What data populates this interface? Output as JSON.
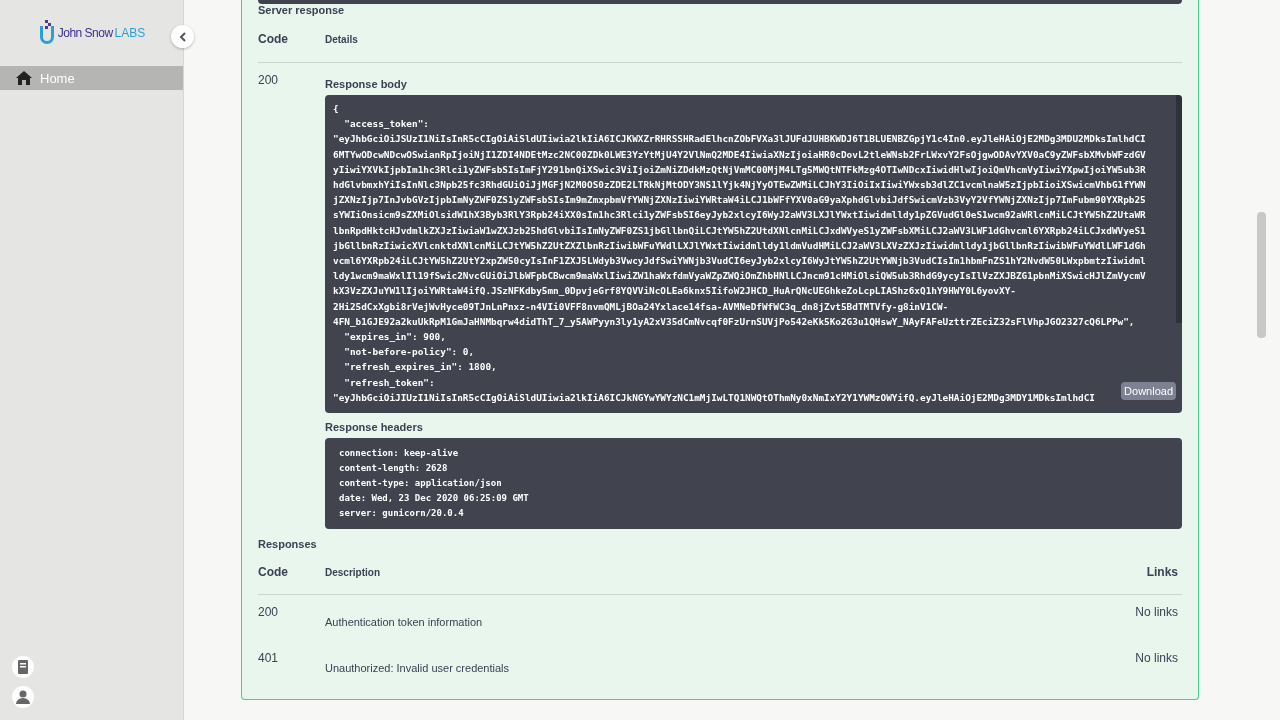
{
  "sidebar": {
    "logo": {
      "name": "John Snow",
      "suffix": "LABS"
    },
    "items": [
      {
        "label": "Home",
        "selected": true
      }
    ]
  },
  "server_response": {
    "title": "Server response",
    "columns": [
      "Code",
      "Details"
    ],
    "code": "200",
    "body_label": "Response body",
    "body_lines": [
      "{",
      "  \"access_token\":",
      "\"eyJhbGciOiJSUzI1NiIsInR5cCIgOiAiSldUIiwia2lkIiA6ICJKWXZrRHRSSHRadElhcnZObFVXa3lJUFdJUHBKWDJ6T1BLUENBZGpjY1c4In0.eyJleHAiOjE2MDg3MDU2MDksImlhdCI",
      "6MTYwODcwNDcwOSwianRpIjoiNjI1ZDI4NDEtMzc2NC00ZDk0LWE3YzYtMjU4Y2VlNmQ2MDE4IiwiaXNzIjoiaHR0cDovL2tleWNsb2FrLWxvY2FsOjgwODAvYXV0aC9yZWFsbXMvbWFzdGV",
      "yIiwiYXVkIjpbIm1hc3Rlci1yZWFsbSIsImFjY291bnQiXSwic3ViIjoiZmNiZDdkMzQtNjVmMC00MjM4LTg5MWQtNTFkMzg4OTIwNDcxIiwidHlwIjoiQmVhcmVyIiwiYXpwIjoiYW5ub3R",
      "hdGlvbmxhYiIsInNlc3Npb25fc3RhdGUiOiJjMGFjN2M0OS0zZDE2LTRkNjMtODY3NS1lYjk4NjYyOTEwZWMiLCJhY3IiOiIxIiwiYWxsb3dlZC1vcmlnaW5zIjpbIioiXSwicmVhbG1fYWN",
      "jZXNzIjp7InJvbGVzIjpbImNyZWF0ZS1yZWFsbSIsIm9mZmxpbmVfYWNjZXNzIiwiYWRtaW4iLCJ1bWFfYXV0aG9yaXphdGlvbiJdfSwicmVzb3VyY2VfYWNjZXNzIjp7ImFubm90YXRpb25",
      "sYWIiOnsicm9sZXMiOlsidW1hX3Byb3RlY3Rpb24iXX0sIm1hc3Rlci1yZWFsbSI6eyJyb2xlcyI6WyJ2aWV3LXJlYWxtIiwidmlldy1pZGVudGl0eS1wcm92aWRlcnMiLCJtYW5hZ2UtaWR",
      "lbnRpdHktcHJvdmlkZXJzIiwiaW1wZXJzb25hdGlvbiIsImNyZWF0ZS1jbGllbnQiLCJtYW5hZ2UtdXNlcnMiLCJxdWVyeS1yZWFsbXMiLCJ2aWV3LWF1dGhvcml6YXRpb24iLCJxdWVyeS1",
      "jbGllbnRzIiwicXVlcnktdXNlcnMiLCJtYW5hZ2UtZXZlbnRzIiwibWFuYWdlLXJlYWxtIiwidmlldy1ldmVudHMiLCJ2aWV3LXVzZXJzIiwidmlldy1jbGllbnRzIiwibWFuYWdlLWF1dGh",
      "vcml6YXRpb24iLCJtYW5hZ2UtY2xpZW50cyIsInF1ZXJ5LWdyb3VwcyJdfSwiYWNjb3VudCI6eyJyb2xlcyI6WyJtYW5hZ2UtYWNjb3VudCIsIm1hbmFnZS1hY2NvdW50LWxpbmtzIiwidml",
      "ldy1wcm9maWxlIl19fSwic2NvcGUiOiJlbWFpbCBwcm9maWxlIiwiZW1haWxfdmVyaWZpZWQiOmZhbHNlLCJncm91cHMiOlsiQW5ub3RhdG9ycyIsIlVzZXJBZG1pbnMiXSwicHJlZmVycmV",
      "kX3VzZXJuYW1lIjoiYWRtaW4ifQ.JSzNFKdby5mn_0DpvjeGrf8YQVViNcOLEa6knx5IifoW2JHCD_HuArQNcUEGhkeZoLcpLIAShz6xQ1hY9HWY0L6yovXY-",
      "2Hi25dCxXgbi8rVejWvHyce09TJnLnPnxz-n4VIi0VFF8nvmQMLjBOa24Yxlace14fsa-AVMNeDfWfWC3q_dn8jZvt5BdTMTVfy-g8inV1CW-",
      "4FN_b1GJE92a2kuUkRpM1GmJaHNMbqrw4didThT_7_y5AWPyyn3ly1yA2xV35dCmNvcqf0FzUrnSUVjPo542eKk5Ko2G3u1QHswY_NAyFAFeUzttrZEciZ32sFlVhpJGO2327cQ6LPPw\",",
      "  \"expires_in\": 900,",
      "  \"not-before-policy\": 0,",
      "  \"refresh_expires_in\": 1800,",
      "  \"refresh_token\":",
      "\"eyJhbGciOiJIUzI1NiIsInR5cCIgOiAiSldUIiwia2lkIiA6ICJkNGYwYWYzNC1mMjIwLTQ1NWQtOThmNy0xNmIxY2Y1YWMzOWYifQ.eyJleHAiOjE2MDg3MDY1MDksImlhdCI"
    ],
    "download": "Download",
    "headers_label": "Response headers",
    "header_lines": [
      "connection: keep-alive",
      "content-length: 2628",
      "content-type: application/json",
      "date: Wed, 23 Dec 2020 06:25:09 GMT",
      "server: gunicorn/20.0.4"
    ]
  },
  "responses": {
    "title": "Responses",
    "columns": [
      "Code",
      "Description",
      "Links"
    ],
    "rows": [
      {
        "code": "200",
        "description": "Authentication token information",
        "links": "No links"
      },
      {
        "code": "401",
        "description": "Unauthorized: Invalid user credentials",
        "links": "No links"
      }
    ]
  }
}
